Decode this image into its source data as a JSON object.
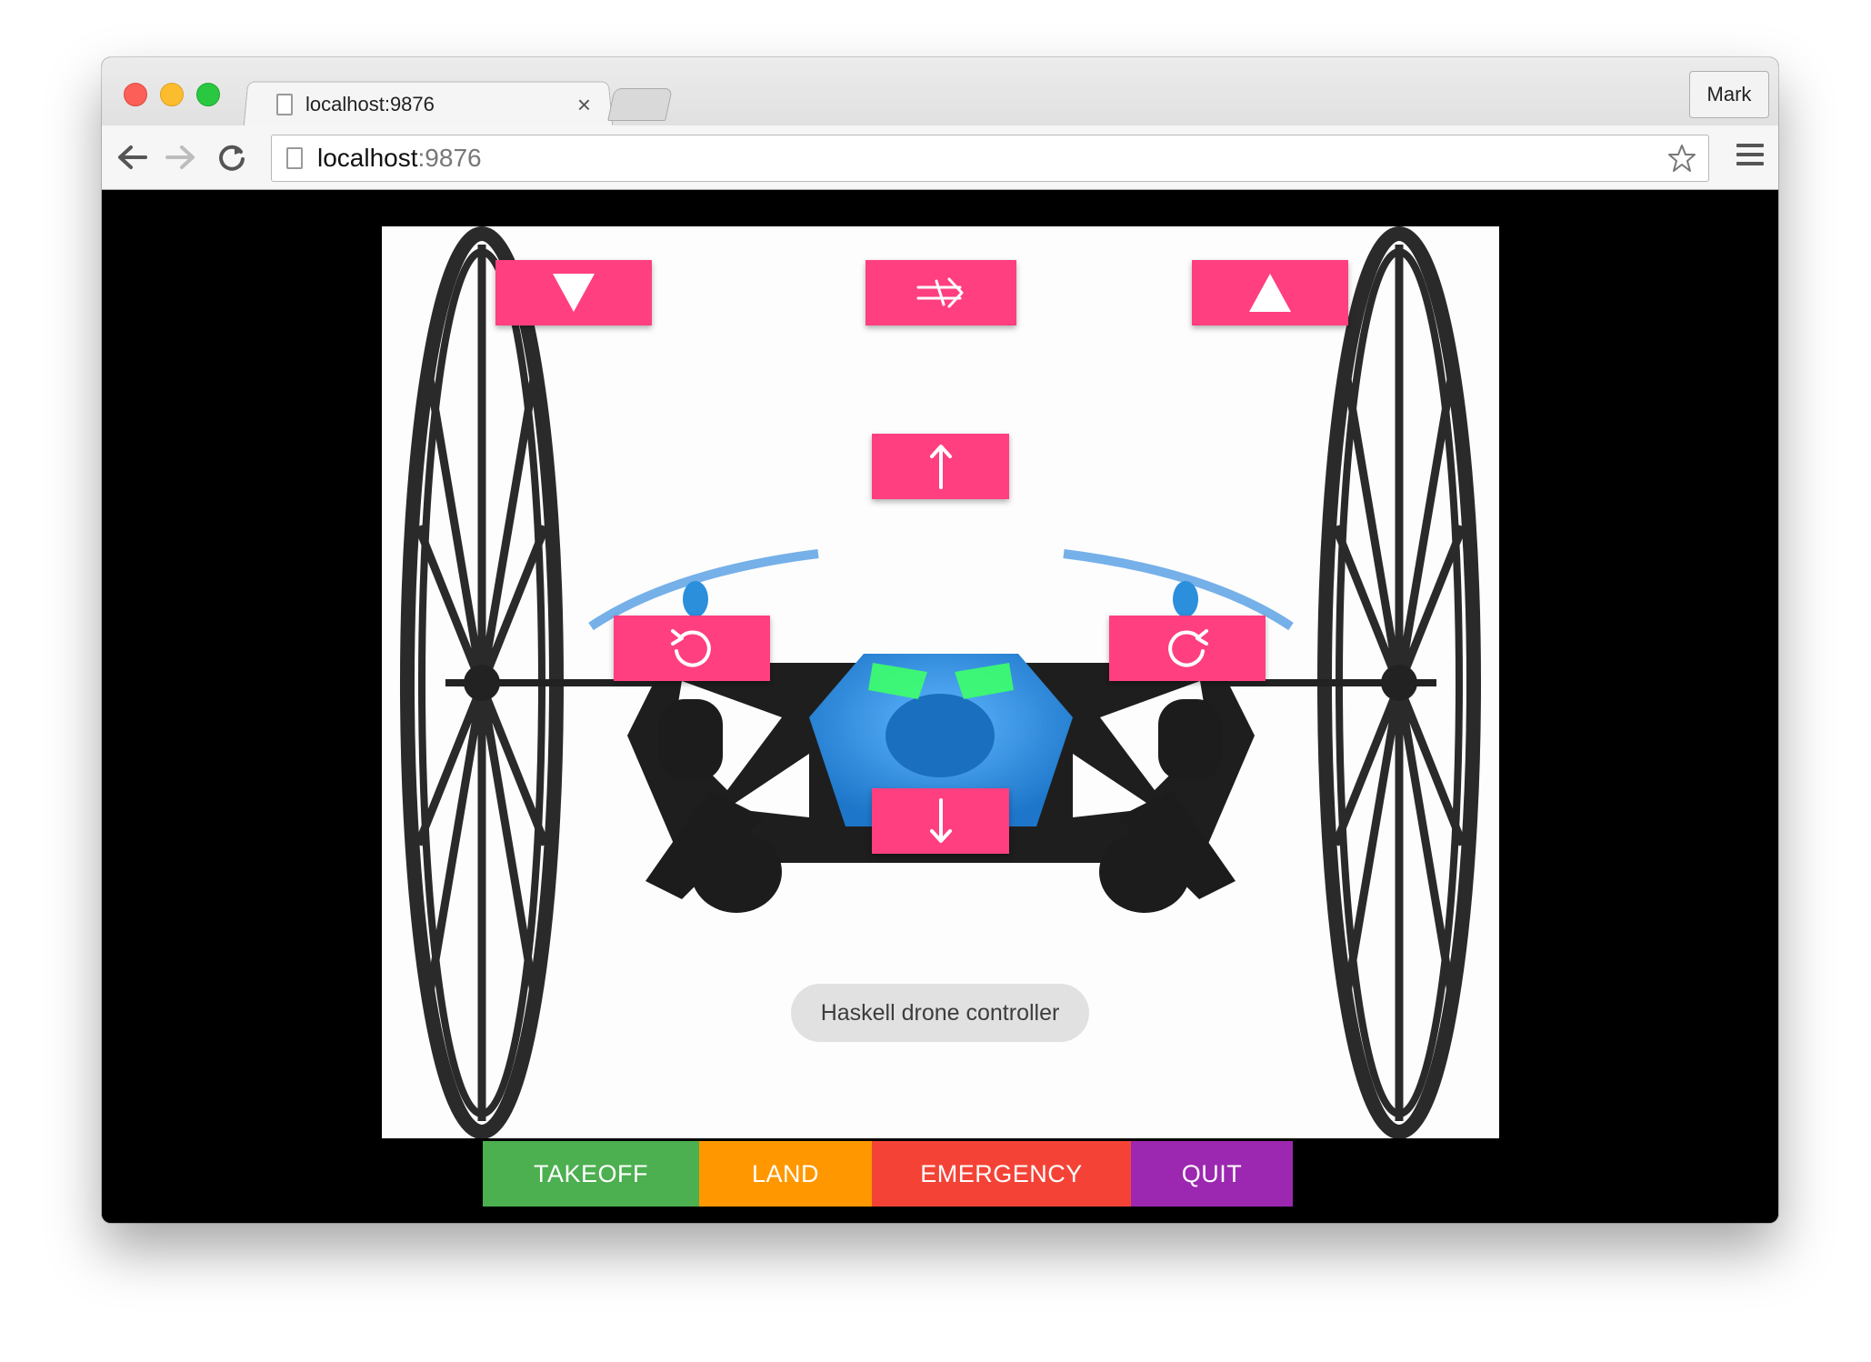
{
  "browser": {
    "tab_title": "localhost:9876",
    "tab_close": "×",
    "profile_name": "Mark",
    "url_host": "localhost",
    "url_port": ":9876"
  },
  "controls": {
    "descend_label": "▼",
    "translate_label": "⇏",
    "ascend_label": "▲",
    "forward_label": "🡡",
    "rotate_left_label": "↺",
    "rotate_right_label": "↻",
    "backward_label": "🡣"
  },
  "title_chip": "Haskell drone controller",
  "actions": {
    "takeoff": "TAKEOFF",
    "land": "LAND",
    "emergency": "EMERGENCY",
    "quit": "QUIT"
  },
  "colors": {
    "control_button": "#ff3f7f",
    "takeoff": "#4caf50",
    "land": "#ff9800",
    "emergency": "#f44336",
    "quit": "#9c27b0",
    "drone_body": "#2b8fdc"
  }
}
